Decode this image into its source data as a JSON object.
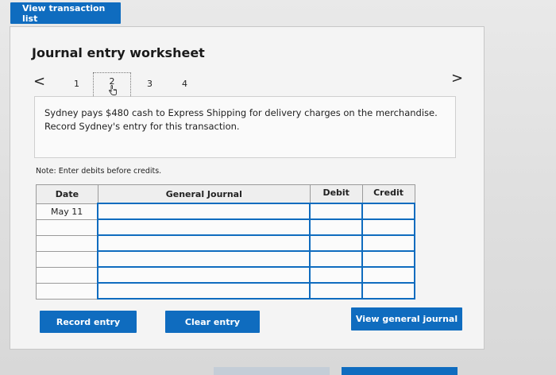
{
  "header": {
    "view_transaction_list": "View transaction list"
  },
  "worksheet": {
    "title": "Journal entry worksheet",
    "pager": {
      "prev": "<",
      "next": ">",
      "pages": [
        "1",
        "2",
        "3",
        "4"
      ],
      "current": "2"
    },
    "description": "Sydney pays $480 cash to Express Shipping for delivery charges on the merchandise. Record Sydney's entry for this transaction.",
    "note": "Note: Enter debits before credits.",
    "table": {
      "headers": {
        "date": "Date",
        "general_journal": "General Journal",
        "debit": "Debit",
        "credit": "Credit"
      },
      "rows": [
        {
          "date": "May 11",
          "account": "",
          "debit": "",
          "credit": ""
        },
        {
          "date": "",
          "account": "",
          "debit": "",
          "credit": ""
        },
        {
          "date": "",
          "account": "",
          "debit": "",
          "credit": ""
        },
        {
          "date": "",
          "account": "",
          "debit": "",
          "credit": ""
        },
        {
          "date": "",
          "account": "",
          "debit": "",
          "credit": ""
        },
        {
          "date": "",
          "account": "",
          "debit": "",
          "credit": ""
        }
      ]
    },
    "buttons": {
      "record_entry": "Record entry",
      "clear_entry": "Clear entry",
      "view_general_journal": "View general journal"
    }
  },
  "colors": {
    "accent": "#0f6cbf",
    "panel": "#f4f4f4"
  }
}
